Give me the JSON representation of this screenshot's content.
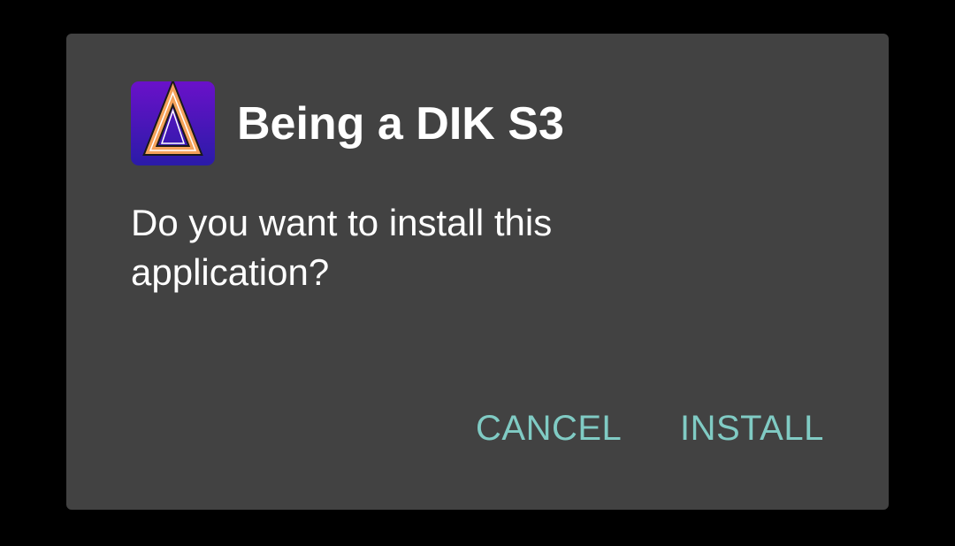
{
  "dialog": {
    "app_name": "Being a DIK S3",
    "app_icon": "triangle-logo-icon",
    "message": "Do you want to install this application?",
    "buttons": {
      "cancel_label": "CANCEL",
      "install_label": "INSTALL"
    }
  },
  "colors": {
    "scrim": "#000000",
    "dialog_background": "#424242",
    "text_primary": "#ffffff",
    "button_accent": "#80cbc4",
    "icon_gradient_top": "#6a11c9",
    "icon_gradient_bottom": "#2a1ba8",
    "icon_triangle": "#f5a25a"
  }
}
